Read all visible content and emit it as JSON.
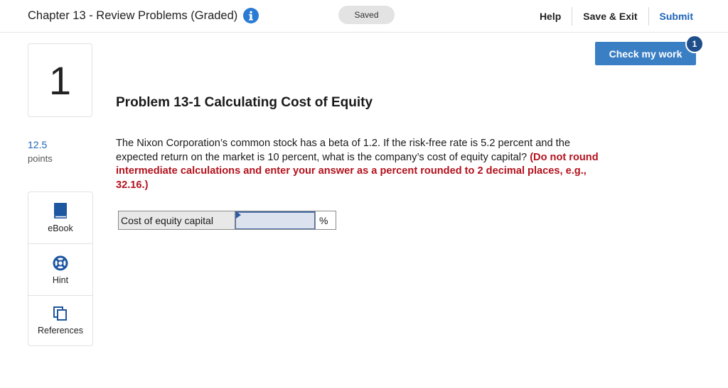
{
  "header": {
    "title": "Chapter 13 - Review Problems (Graded)",
    "saved_label": "Saved",
    "help_label": "Help",
    "save_exit_label": "Save & Exit",
    "submit_label": "Submit"
  },
  "check": {
    "label": "Check my work",
    "badge_count": "1"
  },
  "question": {
    "number": "1",
    "points_value": "12.5",
    "points_label": "points"
  },
  "tools": {
    "ebook_label": "eBook",
    "hint_label": "Hint",
    "references_label": "References"
  },
  "problem": {
    "title": "Problem 13-1 Calculating Cost of Equity",
    "text": "The Nixon Corporation’s common stock has a beta of 1.2. If the risk-free rate is 5.2 percent and the expected return on the market is 10 percent, what is the company’s cost of equity capital? ",
    "instruction": "(Do not round intermediate calculations and enter your answer as a percent rounded to 2 decimal places, e.g., 32.16.)"
  },
  "answer": {
    "label": "Cost of equity capital",
    "value": "",
    "unit": "%"
  },
  "colors": {
    "accent_blue": "#3a7fc4",
    "link_blue": "#1d63b8",
    "instruction_red": "#b3121d"
  },
  "icons": {
    "info": "info-icon",
    "ebook": "book-icon",
    "hint": "lifebuoy-icon",
    "references": "copy-icon"
  }
}
